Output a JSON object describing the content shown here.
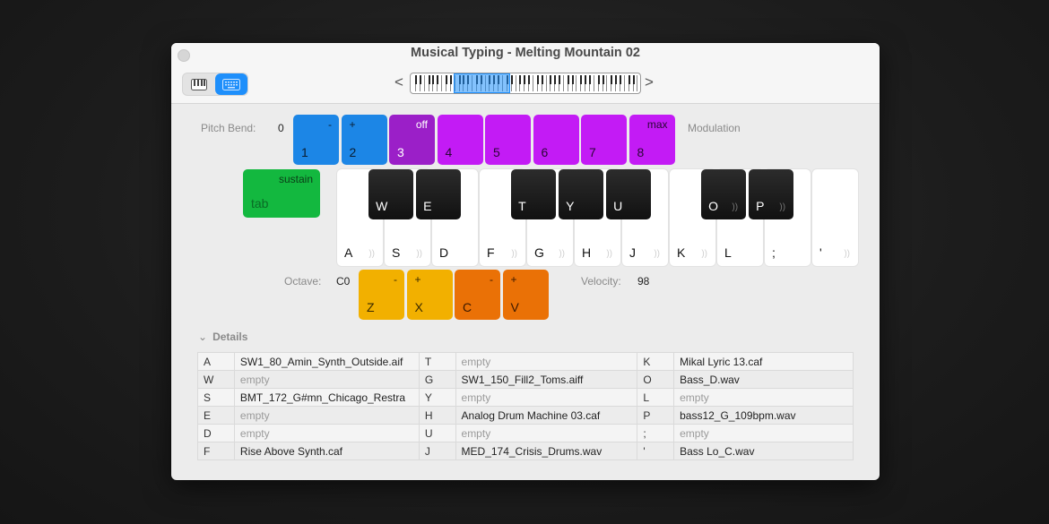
{
  "window": {
    "title": "Musical Typing - Melting Mountain 02",
    "view_modes": [
      {
        "name": "piano",
        "icon": "piano-keys-icon",
        "selected": false
      },
      {
        "name": "keyboard",
        "icon": "keyboard-icon",
        "selected": true
      }
    ],
    "nav_prev": "<",
    "nav_next": ">"
  },
  "pitch_bend": {
    "label": "Pitch Bend:",
    "value": "0",
    "keys": [
      {
        "top": "-",
        "key": "1"
      },
      {
        "top": "+",
        "key": "2"
      }
    ]
  },
  "modulation": {
    "label": "Modulation",
    "keys": [
      {
        "top": "off",
        "key": "3"
      },
      {
        "top": "",
        "key": "4"
      },
      {
        "top": "",
        "key": "5"
      },
      {
        "top": "",
        "key": "6"
      },
      {
        "top": "",
        "key": "7"
      },
      {
        "top": "max",
        "key": "8"
      }
    ]
  },
  "sustain": {
    "label": "sustain",
    "key": "tab"
  },
  "white_keys": [
    "A",
    "S",
    "D",
    "F",
    "G",
    "H",
    "J",
    "K",
    "L",
    ";",
    "'"
  ],
  "black_keys": [
    "W",
    "E",
    "T",
    "Y",
    "U",
    "O",
    "P"
  ],
  "octave": {
    "label": "Octave:",
    "value": "C0",
    "keys": [
      {
        "top": "-",
        "key": "Z"
      },
      {
        "top": "+",
        "key": "X"
      }
    ]
  },
  "velocity": {
    "label": "Velocity:",
    "value": "98",
    "keys": [
      {
        "top": "-",
        "key": "C"
      },
      {
        "top": "+",
        "key": "V"
      }
    ]
  },
  "details": {
    "label": "Details",
    "rows": [
      [
        {
          "k": "A",
          "f": "SW1_80_Amin_Synth_Outside.aif"
        },
        {
          "k": "T",
          "f": "empty"
        },
        {
          "k": "K",
          "f": "Mikal Lyric 13.caf"
        }
      ],
      [
        {
          "k": "W",
          "f": "empty"
        },
        {
          "k": "G",
          "f": "SW1_150_Fill2_Toms.aiff"
        },
        {
          "k": "O",
          "f": "Bass_D.wav"
        }
      ],
      [
        {
          "k": "S",
          "f": "BMT_172_G#mn_Chicago_Restra"
        },
        {
          "k": "Y",
          "f": "empty"
        },
        {
          "k": "L",
          "f": "empty"
        }
      ],
      [
        {
          "k": "E",
          "f": "empty"
        },
        {
          "k": "H",
          "f": "Analog Drum Machine 03.caf"
        },
        {
          "k": "P",
          "f": "bass12_G_109bpm.wav"
        }
      ],
      [
        {
          "k": "D",
          "f": "empty"
        },
        {
          "k": "U",
          "f": "empty"
        },
        {
          "k": ";",
          "f": "empty"
        }
      ],
      [
        {
          "k": "F",
          "f": "Rise Above Synth.caf"
        },
        {
          "k": "J",
          "f": "MED_174_Crisis_Drums.wav"
        },
        {
          "k": "'",
          "f": "Bass Lo_C.wav"
        }
      ]
    ]
  },
  "colors": {
    "pitch": "#1c86e6",
    "mod_off": "#9b1fc8",
    "mod": "#c31bf5",
    "sustain": "#13b83f",
    "octave": "#f2b000",
    "velocity": "#ea7106",
    "accent": "#1e8ffb"
  }
}
